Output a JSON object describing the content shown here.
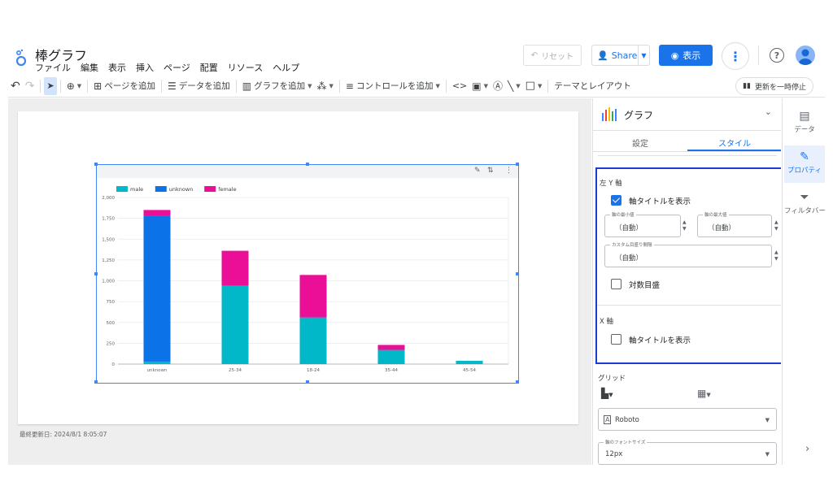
{
  "header": {
    "title": "棒グラフ",
    "menu": [
      "ファイル",
      "編集",
      "表示",
      "挿入",
      "ページ",
      "配置",
      "リソース",
      "ヘルプ"
    ],
    "reset_label": "リセット",
    "share_label": "Share",
    "view_label": "表示",
    "help_label": "?"
  },
  "toolbar": {
    "add_page": "ページを追加",
    "add_data": "データを追加",
    "add_chart": "グラフを追加",
    "add_control": "コントロールを追加",
    "theme_layout": "テーマとレイアウト",
    "pause_updates": "更新を一時停止"
  },
  "canvas": {
    "last_updated": "最終更新日: 2024/8/1 8:05:07"
  },
  "chart_data": {
    "type": "bar",
    "stacked": true,
    "categories": [
      "unknown",
      "25-34",
      "18-24",
      "35-44",
      "45-54"
    ],
    "series": [
      {
        "name": "male",
        "color": "#00b8c8",
        "values": [
          30,
          940,
          560,
          170,
          40
        ]
      },
      {
        "name": "unknown",
        "color": "#0b72e8",
        "values": [
          1750,
          0,
          0,
          0,
          0
        ]
      },
      {
        "name": "female",
        "color": "#ea0f96",
        "values": [
          70,
          420,
          510,
          60,
          0
        ]
      }
    ],
    "yticks": [
      "0",
      "250",
      "500",
      "750",
      "1,000",
      "1,250",
      "1,500",
      "1,750",
      "2,000"
    ],
    "ylim": [
      0,
      2000
    ],
    "legend_position": "top-left",
    "grid": true
  },
  "panel": {
    "title": "グラフ",
    "tabs": [
      "設定",
      "スタイル"
    ],
    "left_y_axis": "左 Y 軸",
    "show_axis_title": "軸タイトルを表示",
    "axis_min_label": "軸の最小値",
    "axis_max_label": "軸の最大値",
    "auto": "（自動）",
    "custom_tick_label": "カスタム目盛り間隔",
    "log_scale": "対数目盛",
    "x_axis": "X 軸",
    "show_x_axis_title": "軸タイトルを表示",
    "grid": "グリッド",
    "font": "Roboto",
    "font_size_label": "軸のフォントサイズ",
    "font_size": "12px"
  },
  "rail": {
    "data": "データ",
    "properties": "プロパティ",
    "filter": "フィルタバー"
  }
}
